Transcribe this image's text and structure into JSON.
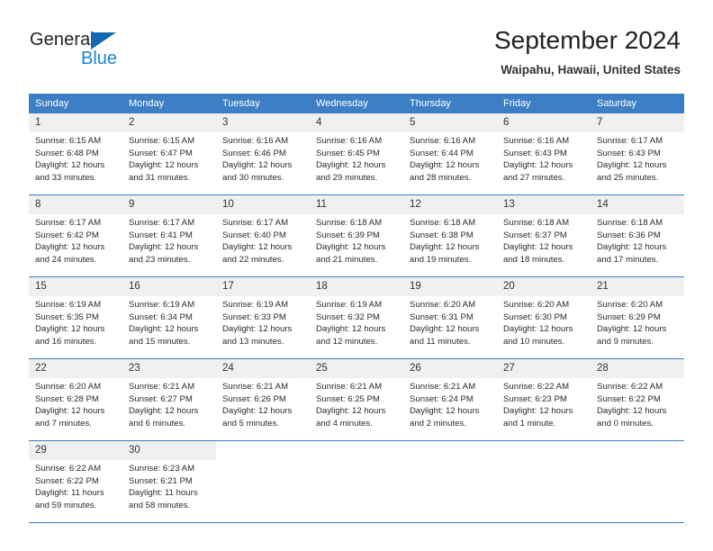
{
  "brand": {
    "name_part1": "General",
    "name_part2": "Blue",
    "triangle_color": "#1268b3",
    "blue_color": "#1b84d6"
  },
  "header": {
    "title": "September 2024",
    "subtitle": "Waipahu, Hawaii, United States"
  },
  "theme": {
    "header_row_bg": "#3c7fc4",
    "daynum_bg": "#f0f0f0",
    "grid_line": "#3c7fc4",
    "page_bg": "#ffffff",
    "text": "#222222"
  },
  "calendar": {
    "weekday_headers": [
      "Sunday",
      "Monday",
      "Tuesday",
      "Wednesday",
      "Thursday",
      "Friday",
      "Saturday"
    ],
    "labels": {
      "sunrise": "Sunrise:",
      "sunset": "Sunset:",
      "daylight": "Daylight:"
    },
    "weeks": [
      [
        {
          "day": "1",
          "sunrise": "Sunrise: 6:15 AM",
          "sunset": "Sunset: 6:48 PM",
          "daylight_1": "Daylight: 12 hours",
          "daylight_2": "and 33 minutes."
        },
        {
          "day": "2",
          "sunrise": "Sunrise: 6:15 AM",
          "sunset": "Sunset: 6:47 PM",
          "daylight_1": "Daylight: 12 hours",
          "daylight_2": "and 31 minutes."
        },
        {
          "day": "3",
          "sunrise": "Sunrise: 6:16 AM",
          "sunset": "Sunset: 6:46 PM",
          "daylight_1": "Daylight: 12 hours",
          "daylight_2": "and 30 minutes."
        },
        {
          "day": "4",
          "sunrise": "Sunrise: 6:16 AM",
          "sunset": "Sunset: 6:45 PM",
          "daylight_1": "Daylight: 12 hours",
          "daylight_2": "and 29 minutes."
        },
        {
          "day": "5",
          "sunrise": "Sunrise: 6:16 AM",
          "sunset": "Sunset: 6:44 PM",
          "daylight_1": "Daylight: 12 hours",
          "daylight_2": "and 28 minutes."
        },
        {
          "day": "6",
          "sunrise": "Sunrise: 6:16 AM",
          "sunset": "Sunset: 6:43 PM",
          "daylight_1": "Daylight: 12 hours",
          "daylight_2": "and 27 minutes."
        },
        {
          "day": "7",
          "sunrise": "Sunrise: 6:17 AM",
          "sunset": "Sunset: 6:43 PM",
          "daylight_1": "Daylight: 12 hours",
          "daylight_2": "and 25 minutes."
        }
      ],
      [
        {
          "day": "8",
          "sunrise": "Sunrise: 6:17 AM",
          "sunset": "Sunset: 6:42 PM",
          "daylight_1": "Daylight: 12 hours",
          "daylight_2": "and 24 minutes."
        },
        {
          "day": "9",
          "sunrise": "Sunrise: 6:17 AM",
          "sunset": "Sunset: 6:41 PM",
          "daylight_1": "Daylight: 12 hours",
          "daylight_2": "and 23 minutes."
        },
        {
          "day": "10",
          "sunrise": "Sunrise: 6:17 AM",
          "sunset": "Sunset: 6:40 PM",
          "daylight_1": "Daylight: 12 hours",
          "daylight_2": "and 22 minutes."
        },
        {
          "day": "11",
          "sunrise": "Sunrise: 6:18 AM",
          "sunset": "Sunset: 6:39 PM",
          "daylight_1": "Daylight: 12 hours",
          "daylight_2": "and 21 minutes."
        },
        {
          "day": "12",
          "sunrise": "Sunrise: 6:18 AM",
          "sunset": "Sunset: 6:38 PM",
          "daylight_1": "Daylight: 12 hours",
          "daylight_2": "and 19 minutes."
        },
        {
          "day": "13",
          "sunrise": "Sunrise: 6:18 AM",
          "sunset": "Sunset: 6:37 PM",
          "daylight_1": "Daylight: 12 hours",
          "daylight_2": "and 18 minutes."
        },
        {
          "day": "14",
          "sunrise": "Sunrise: 6:18 AM",
          "sunset": "Sunset: 6:36 PM",
          "daylight_1": "Daylight: 12 hours",
          "daylight_2": "and 17 minutes."
        }
      ],
      [
        {
          "day": "15",
          "sunrise": "Sunrise: 6:19 AM",
          "sunset": "Sunset: 6:35 PM",
          "daylight_1": "Daylight: 12 hours",
          "daylight_2": "and 16 minutes."
        },
        {
          "day": "16",
          "sunrise": "Sunrise: 6:19 AM",
          "sunset": "Sunset: 6:34 PM",
          "daylight_1": "Daylight: 12 hours",
          "daylight_2": "and 15 minutes."
        },
        {
          "day": "17",
          "sunrise": "Sunrise: 6:19 AM",
          "sunset": "Sunset: 6:33 PM",
          "daylight_1": "Daylight: 12 hours",
          "daylight_2": "and 13 minutes."
        },
        {
          "day": "18",
          "sunrise": "Sunrise: 6:19 AM",
          "sunset": "Sunset: 6:32 PM",
          "daylight_1": "Daylight: 12 hours",
          "daylight_2": "and 12 minutes."
        },
        {
          "day": "19",
          "sunrise": "Sunrise: 6:20 AM",
          "sunset": "Sunset: 6:31 PM",
          "daylight_1": "Daylight: 12 hours",
          "daylight_2": "and 11 minutes."
        },
        {
          "day": "20",
          "sunrise": "Sunrise: 6:20 AM",
          "sunset": "Sunset: 6:30 PM",
          "daylight_1": "Daylight: 12 hours",
          "daylight_2": "and 10 minutes."
        },
        {
          "day": "21",
          "sunrise": "Sunrise: 6:20 AM",
          "sunset": "Sunset: 6:29 PM",
          "daylight_1": "Daylight: 12 hours",
          "daylight_2": "and 9 minutes."
        }
      ],
      [
        {
          "day": "22",
          "sunrise": "Sunrise: 6:20 AM",
          "sunset": "Sunset: 6:28 PM",
          "daylight_1": "Daylight: 12 hours",
          "daylight_2": "and 7 minutes."
        },
        {
          "day": "23",
          "sunrise": "Sunrise: 6:21 AM",
          "sunset": "Sunset: 6:27 PM",
          "daylight_1": "Daylight: 12 hours",
          "daylight_2": "and 6 minutes."
        },
        {
          "day": "24",
          "sunrise": "Sunrise: 6:21 AM",
          "sunset": "Sunset: 6:26 PM",
          "daylight_1": "Daylight: 12 hours",
          "daylight_2": "and 5 minutes."
        },
        {
          "day": "25",
          "sunrise": "Sunrise: 6:21 AM",
          "sunset": "Sunset: 6:25 PM",
          "daylight_1": "Daylight: 12 hours",
          "daylight_2": "and 4 minutes."
        },
        {
          "day": "26",
          "sunrise": "Sunrise: 6:21 AM",
          "sunset": "Sunset: 6:24 PM",
          "daylight_1": "Daylight: 12 hours",
          "daylight_2": "and 2 minutes."
        },
        {
          "day": "27",
          "sunrise": "Sunrise: 6:22 AM",
          "sunset": "Sunset: 6:23 PM",
          "daylight_1": "Daylight: 12 hours",
          "daylight_2": "and 1 minute."
        },
        {
          "day": "28",
          "sunrise": "Sunrise: 6:22 AM",
          "sunset": "Sunset: 6:22 PM",
          "daylight_1": "Daylight: 12 hours",
          "daylight_2": "and 0 minutes."
        }
      ],
      [
        {
          "day": "29",
          "sunrise": "Sunrise: 6:22 AM",
          "sunset": "Sunset: 6:22 PM",
          "daylight_1": "Daylight: 11 hours",
          "daylight_2": "and 59 minutes."
        },
        {
          "day": "30",
          "sunrise": "Sunrise: 6:23 AM",
          "sunset": "Sunset: 6:21 PM",
          "daylight_1": "Daylight: 11 hours",
          "daylight_2": "and 58 minutes."
        },
        {
          "day": "",
          "sunrise": "",
          "sunset": "",
          "daylight_1": "",
          "daylight_2": ""
        },
        {
          "day": "",
          "sunrise": "",
          "sunset": "",
          "daylight_1": "",
          "daylight_2": ""
        },
        {
          "day": "",
          "sunrise": "",
          "sunset": "",
          "daylight_1": "",
          "daylight_2": ""
        },
        {
          "day": "",
          "sunrise": "",
          "sunset": "",
          "daylight_1": "",
          "daylight_2": ""
        },
        {
          "day": "",
          "sunrise": "",
          "sunset": "",
          "daylight_1": "",
          "daylight_2": ""
        }
      ]
    ]
  }
}
